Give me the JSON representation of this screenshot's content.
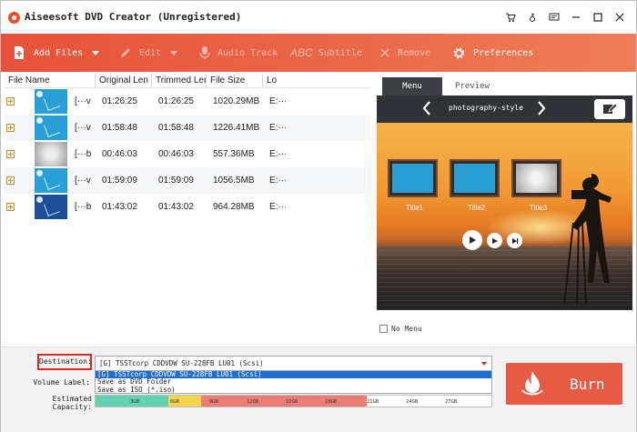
{
  "window": {
    "title": "Aiseesoft DVD Creator (Unregistered)",
    "controls": [
      "cart-icon",
      "key-icon",
      "feedback-icon",
      "minimize-icon",
      "maximize-icon",
      "close-icon"
    ]
  },
  "toolbar": {
    "add_files": "Add Files",
    "edit": "Edit",
    "audio_track": "Audio Track",
    "subtitle": "Subtitle",
    "subtitle_abc": "ABC",
    "remove": "Remove",
    "preferences": "Preferences"
  },
  "filelist": {
    "columns": [
      "File Name",
      "Original Len",
      "Trimmed Len",
      "File Size",
      "Lo"
    ],
    "rows": [
      {
        "name": "[···v",
        "original": "01:26:25",
        "trimmed": "01:26:25",
        "size": "1020.29MB",
        "lo": "E:···",
        "thumb": "blue"
      },
      {
        "name": "[···v",
        "original": "01:58:48",
        "trimmed": "01:58:48",
        "size": "1226.41MB",
        "lo": "E:···",
        "thumb": "blue"
      },
      {
        "name": "[···b",
        "original": "00:46:03",
        "trimmed": "00:46:03",
        "size": "557.36MB",
        "lo": "E:···",
        "thumb": "grey"
      },
      {
        "name": "[···v",
        "original": "01:59:09",
        "trimmed": "01:59:09",
        "size": "1056.5MB",
        "lo": "E:···",
        "thumb": "blue"
      },
      {
        "name": "[···b",
        "original": "01:43:02",
        "trimmed": "01:43:02",
        "size": "964.28MB",
        "lo": "E:···",
        "thumb": "dark"
      }
    ]
  },
  "preview": {
    "tabs": [
      "Menu",
      "Preview"
    ],
    "active_tab": "Menu",
    "menu_style": "photography-style",
    "titles": [
      "Title1",
      "Title2",
      "Title3"
    ],
    "no_menu_label": "No Menu"
  },
  "bottom": {
    "destination_label": "Destination:",
    "destination_value": "[G] TSSTcorp CDDVDW SU-228FB LU01 (Scsi)",
    "dropdown_options": [
      "[G] TSSTcorp CDDVDW SU-228FB LU01 (Scsi)",
      "Save as DVD Folder",
      "Save as ISO (*.iso)"
    ],
    "volume_label": "Volume Label:",
    "capacity_label": "Estimated Capacity:",
    "capacity_ticks": [
      "3GB",
      "6GB",
      "9GB",
      "12GB",
      "15GB",
      "18GB",
      "21GB",
      "24GB",
      "27GB"
    ],
    "burn_label": "Burn"
  },
  "colors": {
    "accent": "#e7523a",
    "burn": "#e75a43",
    "highlight": "#d9262a",
    "selection": "#1f6fd3",
    "capacity_green": "#62d2b0",
    "capacity_yellow": "#f5d44e",
    "capacity_red": "#ee7d77"
  }
}
